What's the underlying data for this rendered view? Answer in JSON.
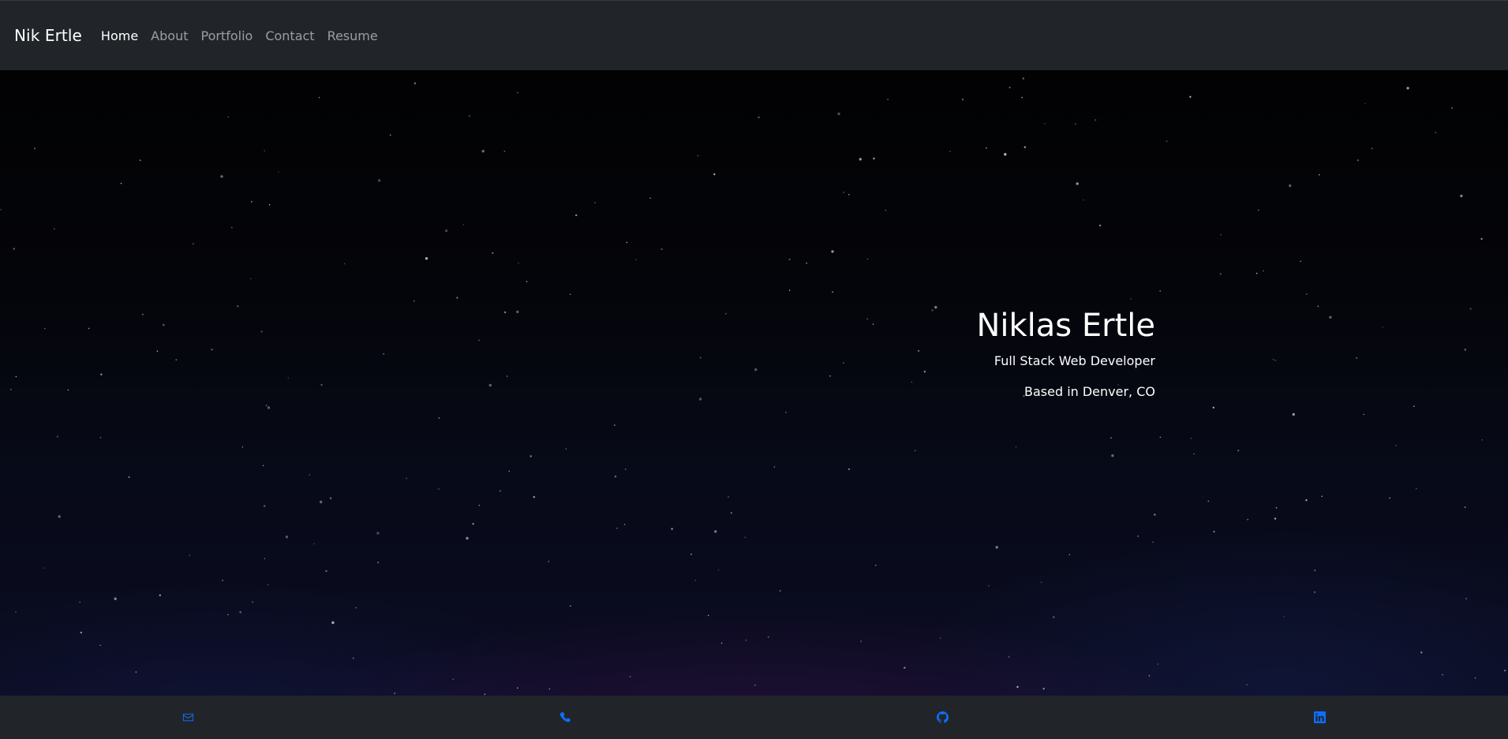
{
  "navbar": {
    "brand": "Nik Ertle",
    "links": [
      {
        "label": "Home",
        "active": true
      },
      {
        "label": "About",
        "active": false
      },
      {
        "label": "Portfolio",
        "active": false
      },
      {
        "label": "Contact",
        "active": false
      },
      {
        "label": "Resume",
        "active": false
      }
    ]
  },
  "hero": {
    "name": "Niklas Ertle",
    "role": "Full Stack Web Developer",
    "location": "Based in Denver, CO"
  },
  "footer": {
    "icons": [
      "envelope-icon",
      "phone-icon",
      "github-icon",
      "linkedin-icon"
    ],
    "icon_color": "#0d6efd"
  },
  "colors": {
    "navbar_bg": "#212529",
    "footer_bg": "#212529",
    "text_primary": "#ffffff",
    "text_muted": "rgba(255,255,255,0.55)"
  }
}
